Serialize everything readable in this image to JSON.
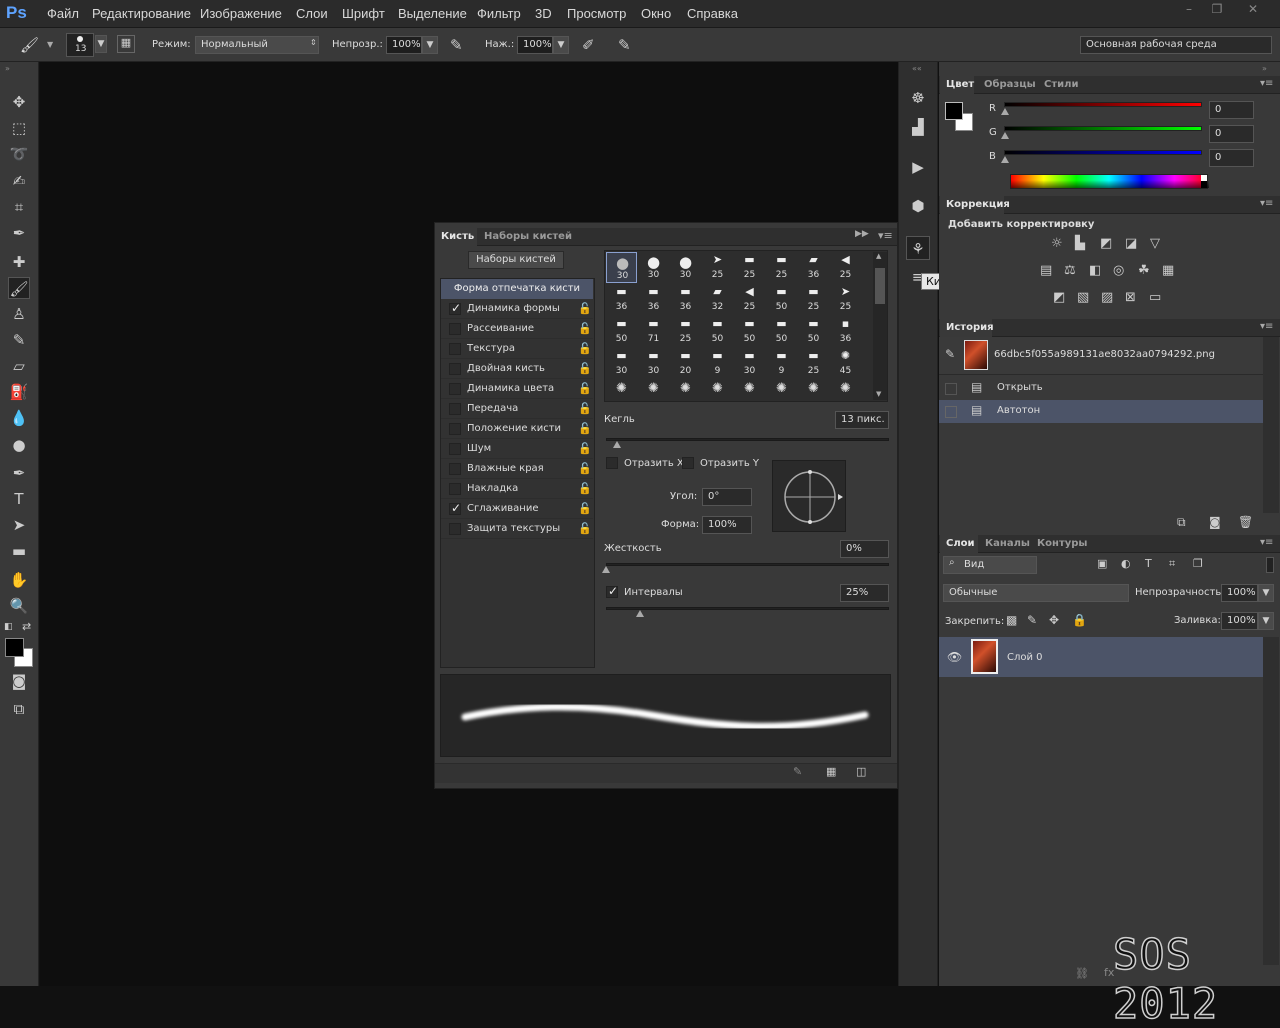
{
  "app": {
    "logo": "Ps"
  },
  "menu": [
    "Файл",
    "Редактирование",
    "Изображение",
    "Слои",
    "Шрифт",
    "Выделение",
    "Фильтр",
    "3D",
    "Просмотр",
    "Окно",
    "Справка"
  ],
  "window_buttons": [
    "–",
    "❐",
    "✕"
  ],
  "options": {
    "brush_size": "13",
    "mode_label": "Режим:",
    "mode_value": "Нормальный",
    "opacity_label": "Непрозр.:",
    "opacity_value": "100%",
    "pressure_label": "Наж.:",
    "pressure_value": "100%",
    "workspace": "Основная рабочая среда"
  },
  "tooltip": "Кисть",
  "brush_panel": {
    "tabs": [
      "Кисть",
      "Наборы кистей"
    ],
    "presets_button": "Наборы кистей",
    "tip_shape": "Форма отпечатка кисти",
    "options": [
      {
        "label": "Динамика формы",
        "checked": true
      },
      {
        "label": "Рассеивание",
        "checked": false
      },
      {
        "label": "Текстура",
        "checked": false
      },
      {
        "label": "Двойная кисть",
        "checked": false
      },
      {
        "label": "Динамика цвета",
        "checked": false
      },
      {
        "label": "Передача",
        "checked": false
      },
      {
        "label": "Положение кисти",
        "checked": false
      },
      {
        "label": "Шум",
        "checked": false
      },
      {
        "label": "Влажные края",
        "checked": false
      },
      {
        "label": "Накладка",
        "checked": false
      },
      {
        "label": "Сглаживание",
        "checked": true
      },
      {
        "label": "Защита текстуры",
        "checked": false
      }
    ],
    "brush_sizes": [
      "30",
      "30",
      "30",
      "25",
      "25",
      "25",
      "36",
      "25",
      "36",
      "36",
      "36",
      "32",
      "25",
      "50",
      "25",
      "25",
      "50",
      "71",
      "25",
      "50",
      "50",
      "50",
      "50",
      "36",
      "30",
      "30",
      "20",
      "9",
      "30",
      "9",
      "25",
      "45"
    ],
    "size_label": "Кегль",
    "size_value": "13 пикс.",
    "flip_x": "Отразить X",
    "flip_y": "Отразить Y",
    "angle_label": "Угол:",
    "angle_value": "0°",
    "roundness_label": "Форма:",
    "roundness_value": "100%",
    "hardness_label": "Жесткость",
    "hardness_value": "0%",
    "spacing_label": "Интервалы",
    "spacing_value": "25%",
    "size_level": 0.04,
    "hardness_level": 0.0,
    "spacing_level": 0.12
  },
  "color_panel": {
    "tabs": [
      "Цвет",
      "Образцы",
      "Стили"
    ],
    "channels": [
      {
        "name": "R",
        "value": "0"
      },
      {
        "name": "G",
        "value": "0"
      },
      {
        "name": "B",
        "value": "0"
      }
    ]
  },
  "adjustments": {
    "tab": "Коррекция",
    "title": "Добавить корректировку"
  },
  "history": {
    "tab": "История",
    "snapshot": "66dbc5f055a989131ae8032aa0794292.png",
    "items": [
      "Открыть",
      "Автотон"
    ]
  },
  "layers": {
    "tabs": [
      "Слои",
      "Каналы",
      "Контуры"
    ],
    "filter": "Вид",
    "blend": "Обычные",
    "opacity_label": "Непрозрачность:",
    "opacity_value": "100%",
    "lock_label": "Закрепить:",
    "fill_label": "Заливка:",
    "fill_value": "100%",
    "layer_name": "Слой 0"
  },
  "watermark": "SOS 2012",
  "colors": {
    "accent": "#5ea3ff",
    "selected_row": "#4c5468",
    "panel": "#393939",
    "dark": "#2b2b2b"
  }
}
